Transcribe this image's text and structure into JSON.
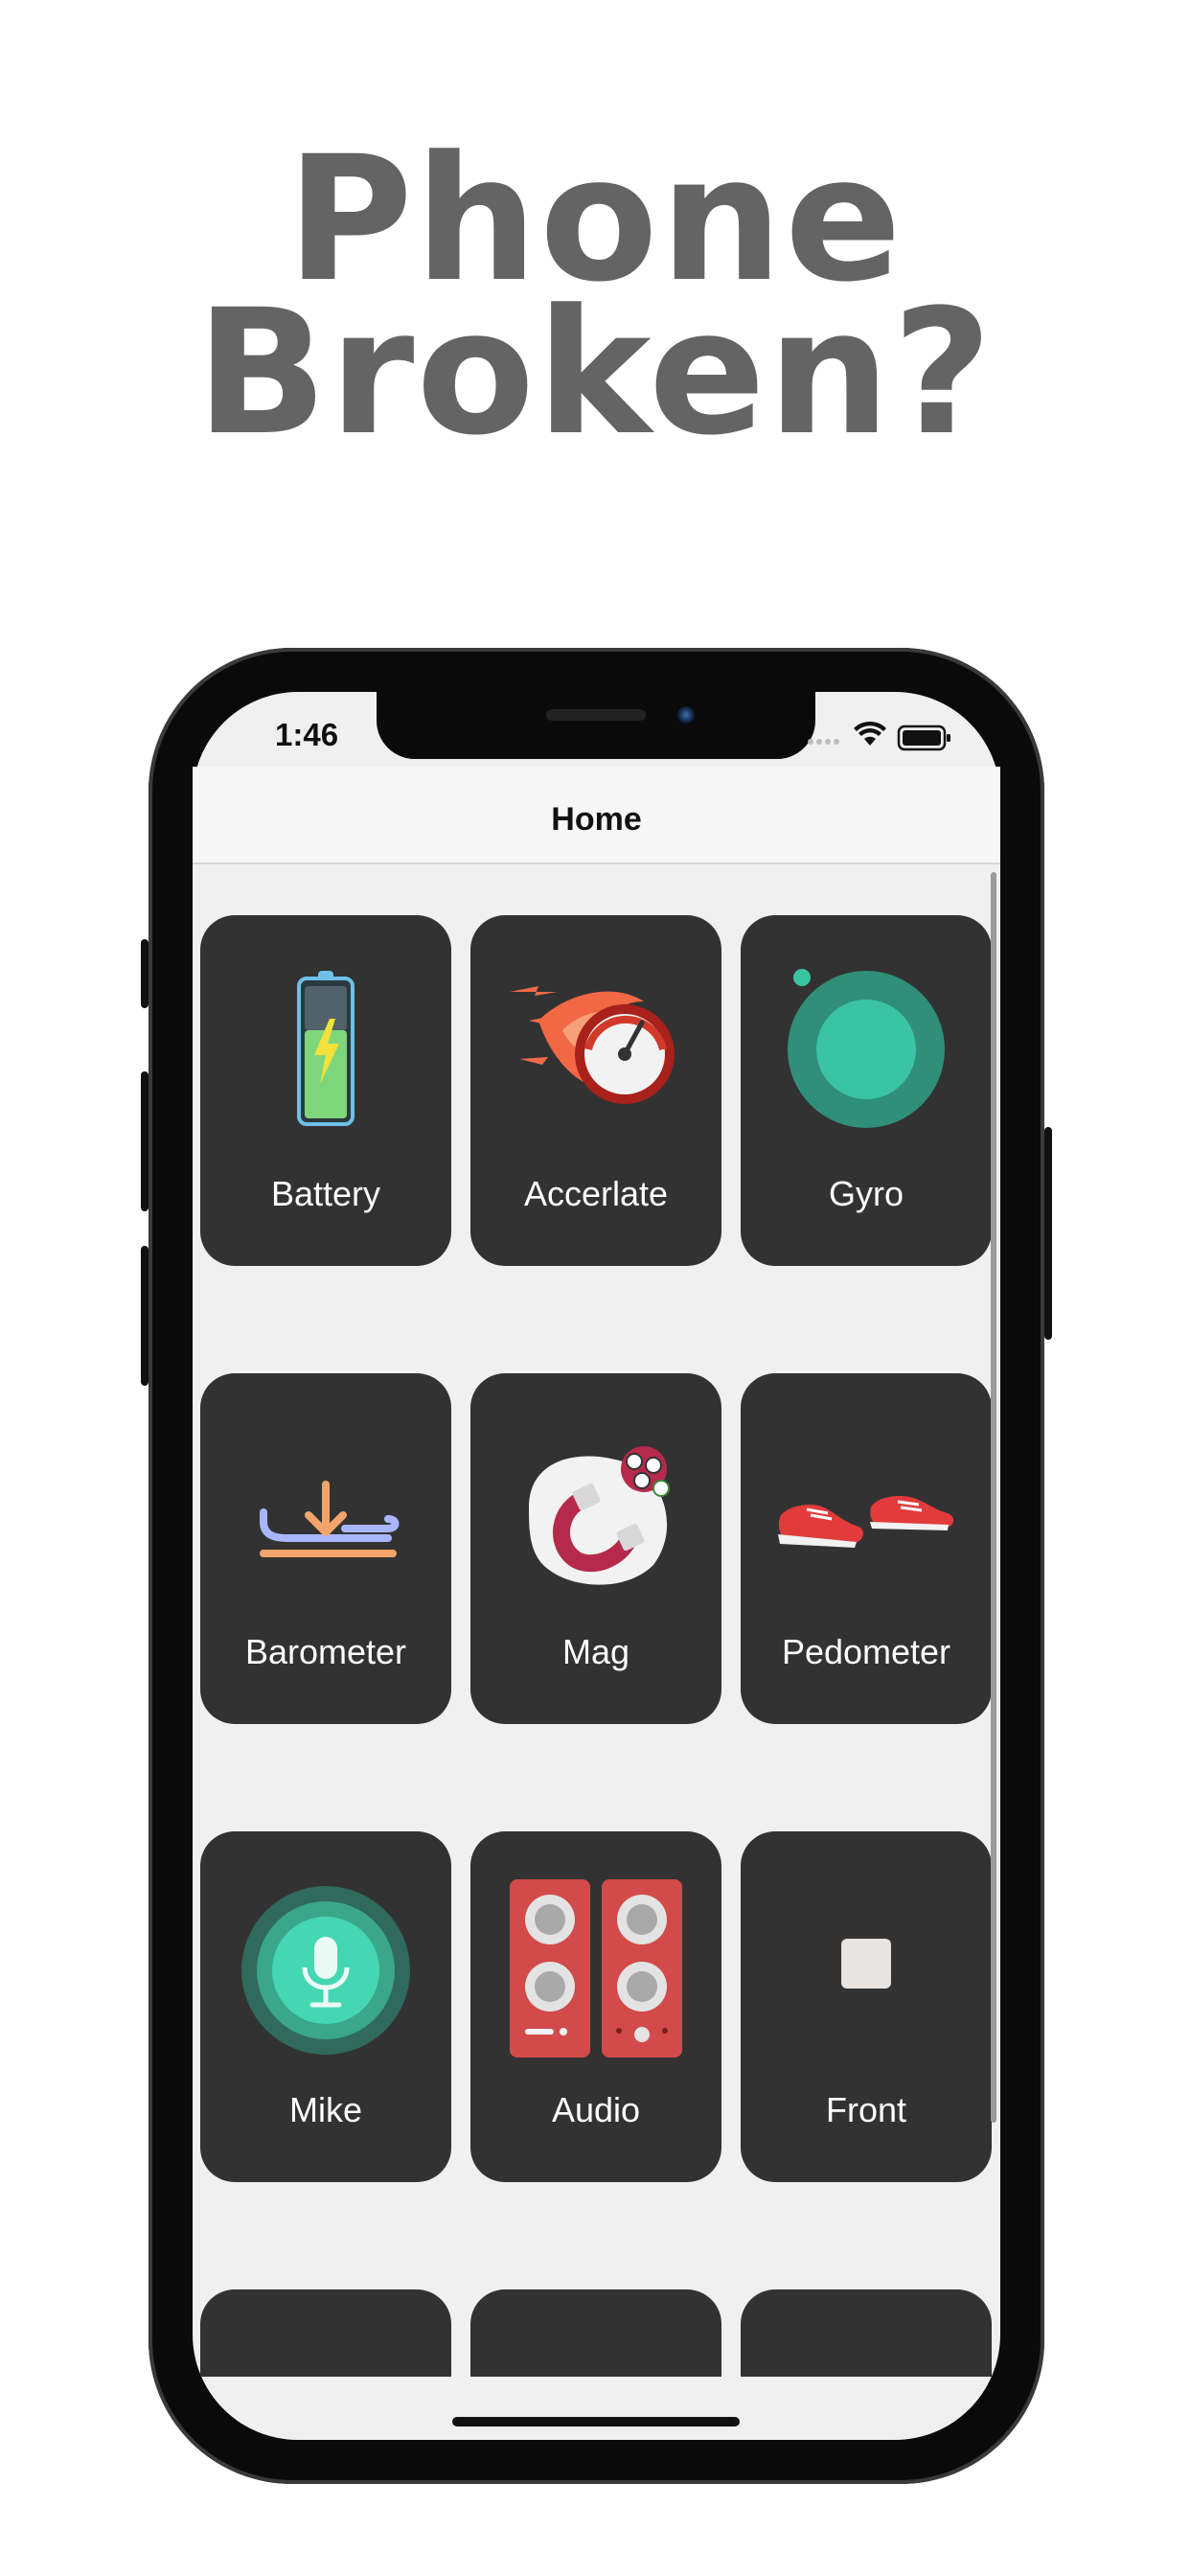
{
  "headline": {
    "line1": "Phone",
    "line2": "Broken?"
  },
  "status_bar": {
    "time": "1:46",
    "wifi_icon": "wifi-icon",
    "battery_icon": "battery-full-icon"
  },
  "nav": {
    "title": "Home"
  },
  "tiles": [
    {
      "label": "Battery",
      "icon": "battery-icon"
    },
    {
      "label": "Accerlate",
      "icon": "speedometer-icon"
    },
    {
      "label": "Gyro",
      "icon": "gyro-icon"
    },
    {
      "label": "Barometer",
      "icon": "barometer-icon"
    },
    {
      "label": "Mag",
      "icon": "magnet-icon"
    },
    {
      "label": "Pedometer",
      "icon": "sneakers-icon"
    },
    {
      "label": "Mike",
      "icon": "microphone-icon"
    },
    {
      "label": "Audio",
      "icon": "speakers-icon"
    },
    {
      "label": "Front",
      "icon": "square-icon"
    }
  ],
  "colors": {
    "tile": "#323232",
    "headline": "#646464",
    "accent_teal": "#3bc4a3",
    "accent_blue": "#1a6eff"
  }
}
